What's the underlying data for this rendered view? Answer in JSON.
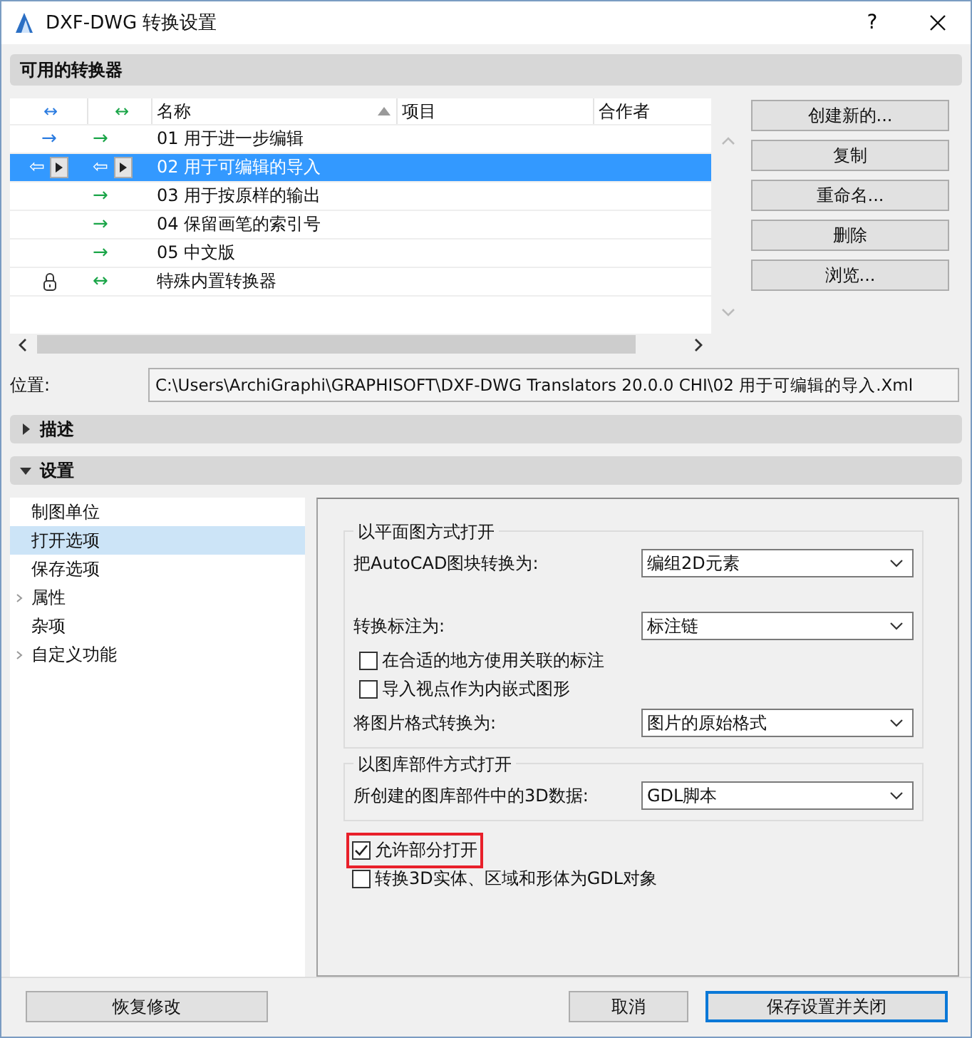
{
  "window": {
    "title": "DXF-DWG 转换设置",
    "help": "?"
  },
  "translators": {
    "title": "可用的转换器",
    "columns": [
      {
        "label": "↔",
        "kind": "import",
        "sorted": false
      },
      {
        "label": "↔",
        "kind": "export",
        "sorted": false
      },
      {
        "label": "名称",
        "kind": "text",
        "sorted": true
      },
      {
        "label": "项目",
        "kind": "text",
        "sorted": false
      },
      {
        "label": "合作者",
        "kind": "text",
        "sorted": false
      }
    ],
    "rows": [
      {
        "import": "→",
        "export": "→",
        "name": "01 用于进一步编辑",
        "selected": false,
        "menu_button": false,
        "locked": false
      },
      {
        "import": "⇦",
        "export": "⇦",
        "name": "02 用于可编辑的导入",
        "selected": true,
        "menu_button": true,
        "locked": false
      },
      {
        "import": "",
        "export": "→",
        "name": "03 用于按原样的输出",
        "selected": false,
        "menu_button": false,
        "locked": false
      },
      {
        "import": "",
        "export": "→",
        "name": "04 保留画笔的索引号",
        "selected": false,
        "menu_button": false,
        "locked": false
      },
      {
        "import": "",
        "export": "→",
        "name": "05 中文版",
        "selected": false,
        "menu_button": false,
        "locked": false
      },
      {
        "import": "",
        "export": "↔",
        "name": "特殊内置转换器",
        "selected": false,
        "menu_button": false,
        "locked": true
      }
    ],
    "buttons": [
      "创建新的...",
      "复制",
      "重命名...",
      "删除",
      "浏览..."
    ],
    "location_label": "位置:",
    "location": "C:\\Users\\ArchiGraphi\\GRAPHISOFT\\DXF-DWG Translators 20.0.0 CHI\\02 用于可编辑的导入.Xml"
  },
  "sections": [
    {
      "title": "描述",
      "expanded": false
    },
    {
      "title": "设置",
      "expanded": true
    }
  ],
  "settings_tree": [
    {
      "label": "制图单位",
      "selected": false,
      "expandable": false
    },
    {
      "label": "打开选项",
      "selected": true,
      "expandable": false
    },
    {
      "label": "保存选项",
      "selected": false,
      "expandable": false
    },
    {
      "label": "属性",
      "selected": false,
      "expandable": true
    },
    {
      "label": "杂项",
      "selected": false,
      "expandable": false
    },
    {
      "label": "自定义功能",
      "selected": false,
      "expandable": true
    }
  ],
  "groups": [
    {
      "title": "以平面图方式打开",
      "items": [
        {
          "kind": "select",
          "label": "把AutoCAD图块转换为:",
          "value": "编组2D元素"
        },
        {
          "kind": "spacer"
        },
        {
          "kind": "select",
          "label": "转换标注为:",
          "value": "标注链"
        },
        {
          "kind": "checkbox",
          "label": "在合适的地方使用关联的标注",
          "checked": false,
          "highlighted": false
        },
        {
          "kind": "checkbox",
          "label": "导入视点作为内嵌式图形",
          "checked": false,
          "highlighted": false
        },
        {
          "kind": "select",
          "label": "将图片格式转换为:",
          "value": "图片的原始格式"
        }
      ]
    },
    {
      "title": "以图库部件方式打开",
      "items": [
        {
          "kind": "select",
          "label": "所创建的图库部件中的3D数据:",
          "value": "GDL脚本"
        }
      ]
    }
  ],
  "options": [
    {
      "label": "允许部分打开",
      "checked": true,
      "highlighted": true
    },
    {
      "label": "转换3D实体、区域和形体为GDL对象",
      "checked": false,
      "highlighted": false
    }
  ],
  "footer": {
    "left_buttons": [
      {
        "label": "恢复修改",
        "default": false
      }
    ],
    "right_buttons": [
      {
        "label": "取消",
        "default": false
      },
      {
        "label": "保存设置并关闭",
        "default": true
      }
    ]
  }
}
